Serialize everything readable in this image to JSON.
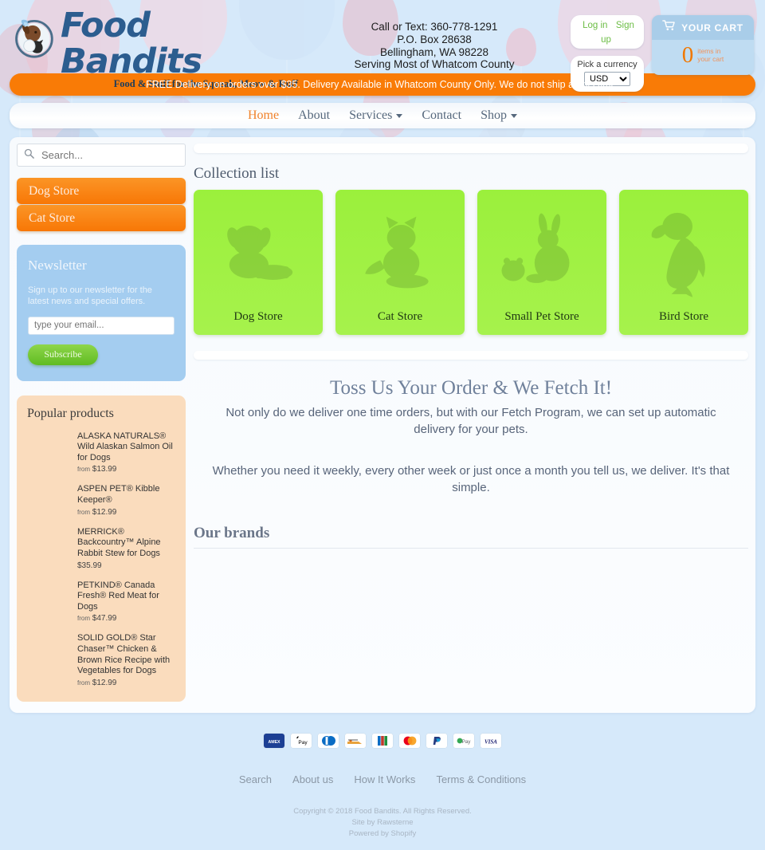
{
  "brand": {
    "name": "Food Bandits",
    "tagline": "Food & Stuff for the Squeak, Meow & Ruff",
    "logo_icon": "dog-cat-bird-badge-logo"
  },
  "header": {
    "contact_lines": [
      "Call or Text: 360-778-1291",
      "P.O. Box 28638",
      "Bellingham, WA 98228",
      "Serving Most of Whatcom County"
    ],
    "login_label": "Log in",
    "signup_label": "Sign up",
    "currency_label": "Pick a currency",
    "currency_value": "USD",
    "currency_options": [
      "USD"
    ],
    "cart_title": "YOUR CART",
    "cart_count": "0",
    "cart_sub_line1": "items in",
    "cart_sub_line2": "your cart",
    "cart_icon": "shopping-cart-icon"
  },
  "announcement": {
    "text": "FREE Delivery on orders over $35. Delivery Available in Whatcom County Only. We do not ship at this time."
  },
  "nav": {
    "items": [
      {
        "label": "Home",
        "active": true,
        "has_caret": false
      },
      {
        "label": "About",
        "active": false,
        "has_caret": false
      },
      {
        "label": "Services",
        "active": false,
        "has_caret": true
      },
      {
        "label": "Contact",
        "active": false,
        "has_caret": false
      },
      {
        "label": "Shop",
        "active": false,
        "has_caret": true
      }
    ]
  },
  "sidebar": {
    "search_placeholder": "Search...",
    "search_value": "",
    "search_icon": "search-icon",
    "store_buttons": [
      {
        "label": "Dog Store"
      },
      {
        "label": "Cat Store"
      }
    ],
    "newsletter": {
      "title": "Newsletter",
      "copy": "Sign up to our newsletter for the latest news and special offers.",
      "email_placeholder": "type your email...",
      "email_value": "",
      "button_label": "Subscribe"
    },
    "popular": {
      "title": "Popular products",
      "items": [
        {
          "name": "ALASKA NATURALS® Wild Alaskan Salmon Oil for Dogs",
          "from": "from",
          "price": "$13.99"
        },
        {
          "name": "ASPEN PET® Kibble Keeper®",
          "from": "from",
          "price": "$12.99"
        },
        {
          "name": "MERRICK® Backcountry™ Alpine Rabbit Stew for Dogs",
          "from": "",
          "price": "$35.99"
        },
        {
          "name": "PETKIND® Canada Fresh® Red Meat for Dogs",
          "from": "from",
          "price": "$47.99"
        },
        {
          "name": "SOLID GOLD® Star Chaser™ Chicken & Brown Rice Recipe with Vegetables for Dogs",
          "from": "from",
          "price": "$12.99"
        }
      ]
    }
  },
  "main": {
    "collection_title": "Collection list",
    "collections": [
      {
        "label": "Dog Store",
        "art": "puppy-with-bowl-icon"
      },
      {
        "label": "Cat Store",
        "art": "cat-with-bowl-icon"
      },
      {
        "label": "Small Pet Store",
        "art": "rabbit-and-hamster-icon"
      },
      {
        "label": "Bird Store",
        "art": "parrot-icon"
      }
    ],
    "promo_heading": "Toss Us Your Order & We Fetch It!",
    "promo_paragraph_1": "Not only do we deliver one time orders, but with our Fetch Program, we can set up automatic delivery for your pets.",
    "promo_paragraph_2": "Whether you need it weekly, every other week or just once a month you tell us, we deliver. It's that simple.",
    "brands_heading": "Our brands"
  },
  "footer": {
    "payment_methods": [
      "American Express",
      "Apple Pay",
      "Diners Club",
      "Discover",
      "JCB",
      "Mastercard",
      "PayPal",
      "Google Pay",
      "Visa"
    ],
    "links": [
      "Search",
      "About us",
      "How It Works",
      "Terms & Conditions"
    ],
    "legal_lines": [
      "Copyright © 2018 Food Bandits. All Rights Reserved.",
      "Site by Rawsterne",
      "Powered by Shopify"
    ]
  },
  "colors": {
    "page_bg": "#d6e9fa",
    "accent_orange": "#f97b06",
    "nav_active": "#f0822a",
    "collection_green": "#9bf03c",
    "newsletter_blue": "#a4cdf0",
    "popular_peach": "#fadcbd",
    "link_green": "#6cbd45"
  }
}
